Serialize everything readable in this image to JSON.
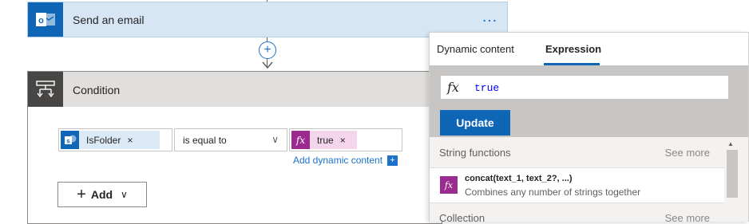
{
  "email_card": {
    "title": "Send an email",
    "more_label": "…",
    "icon": "outlook-icon",
    "icon_letter": "o"
  },
  "connector": {
    "plus": "+"
  },
  "condition": {
    "title": "Condition",
    "icon": "condition-icon",
    "left_token": {
      "label": "IsFolder",
      "remove": "×",
      "icon": "sharepoint-icon",
      "icon_letter": "s"
    },
    "operator": {
      "value": "is equal to",
      "chevron": "∨"
    },
    "right_token": {
      "label": "true",
      "remove": "×",
      "icon": "fx-icon",
      "icon_text": "fx"
    },
    "add_dynamic": "Add dynamic content",
    "add_dynamic_icon": "+",
    "add_button": {
      "plus": "+",
      "label": "Add",
      "chevron": "∨"
    }
  },
  "panel": {
    "tabs": [
      {
        "label": "Dynamic content",
        "active": false
      },
      {
        "label": "Expression",
        "active": true
      }
    ],
    "expression": {
      "fx": "fx",
      "value": "true"
    },
    "update_label": "Update",
    "sections": [
      {
        "title": "String functions",
        "see_more": "See more"
      },
      {
        "title": "Collection",
        "see_more": "See more"
      }
    ],
    "function_item": {
      "name": "concat(text_1, text_2?, ...)",
      "description": "Combines any number of strings together",
      "icon_text": "fx"
    },
    "scroll_up": "▲"
  },
  "colors": {
    "accent": "#0f66b6",
    "email_card_bg": "#d6e6f5",
    "condition_header_bg": "#e1dfdd",
    "fx_token_bg": "#f3d5ec",
    "fx_icon_bg": "#9c2b8f"
  }
}
